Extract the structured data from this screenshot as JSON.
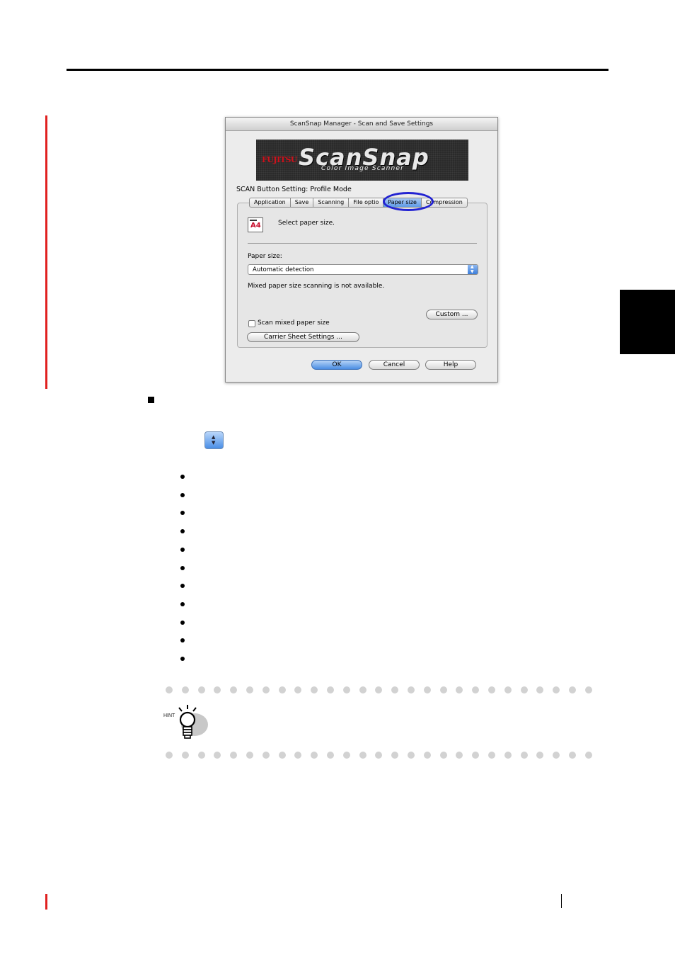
{
  "dialog": {
    "title": "ScanSnap Manager - Scan and Save Settings",
    "brand": {
      "logo_red": "FU",
      "logo_rest": "JITSU",
      "product": "ScanSnap",
      "tagline": "Color Image Scanner"
    },
    "mode_label": "SCAN Button Setting: Profile Mode",
    "tabs": [
      {
        "label": "Application"
      },
      {
        "label": "Save"
      },
      {
        "label": "Scanning"
      },
      {
        "label": "File optio"
      },
      {
        "label": "Paper size"
      },
      {
        "label": "Compression"
      }
    ],
    "selected_tab": "Paper size",
    "icon_label": "A4",
    "instruction": "Select paper size.",
    "paper_size_label": "Paper size:",
    "paper_size_value": "Automatic detection",
    "mixed_note": "Mixed paper size scanning is not available.",
    "custom_button": "Custom ...",
    "checkbox_label": "Scan mixed paper size",
    "checkbox_checked": false,
    "carrier_button": "Carrier Sheet Settings ...",
    "ok_button": "OK",
    "cancel_button": "Cancel",
    "help_button": "Help"
  },
  "hint": {
    "label": "HINT"
  },
  "colors": {
    "accent_red": "#e0201f",
    "highlight_blue": "#2323d2",
    "aqua_blue": "#4b8de3"
  }
}
